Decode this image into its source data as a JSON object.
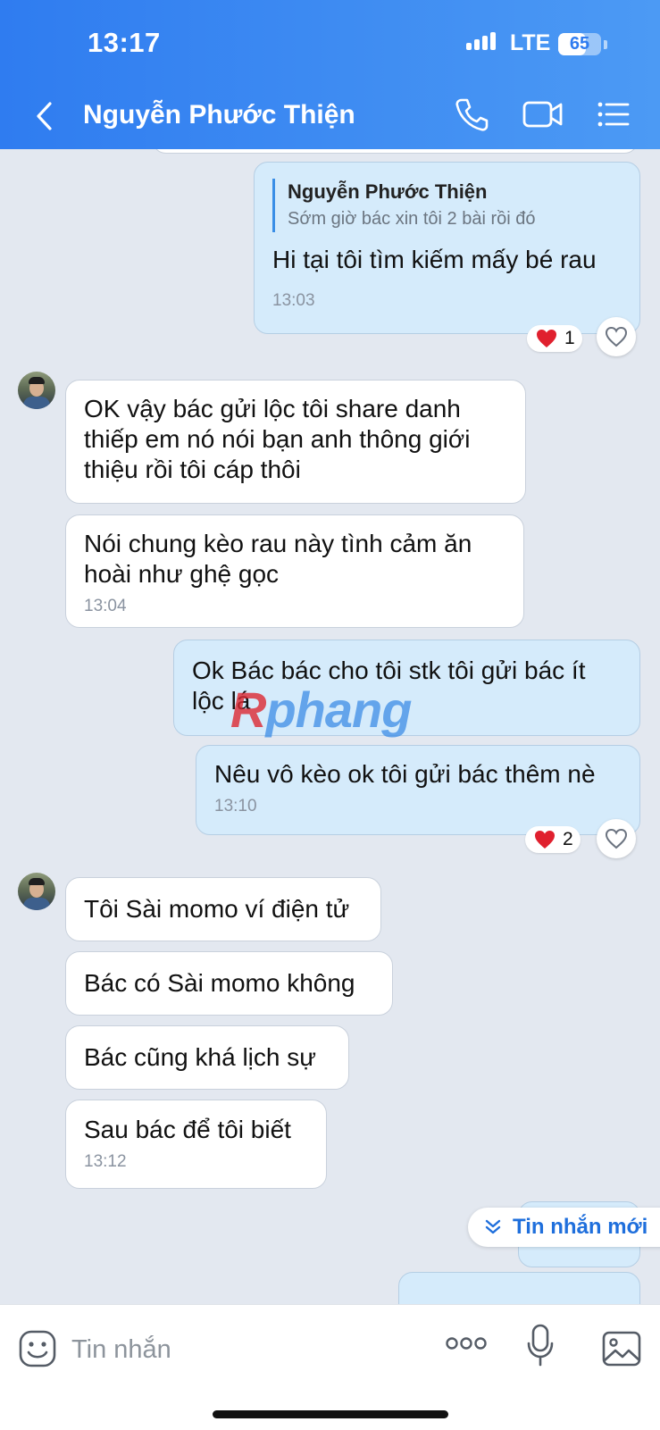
{
  "status_bar": {
    "time": "13:17",
    "network": "LTE",
    "battery": "65",
    "battery_level": 0.65
  },
  "header": {
    "contact_name": "Nguyễn Phước Thiện"
  },
  "messages": {
    "m1": {
      "quote_name": "Nguyễn Phước Thiện",
      "quote_text": "Sớm giờ bác xin tôi 2 bài rồi đó",
      "text": "Hi tại tôi tìm kiếm mấy bé rau",
      "time": "13:03",
      "reaction_count": "1"
    },
    "m2": {
      "text": "OK vậy bác gửi lộc tôi share danh thiếp em nó nói bạn anh thông giới thiệu rồi tôi cáp thôi"
    },
    "m3": {
      "text": "Nói chung kèo rau này tình cảm ăn hoài như ghệ gọc",
      "time": "13:04"
    },
    "m4": {
      "text": "Ok Bác bác cho tôi stk tôi gửi bác ít lộc lá"
    },
    "m5": {
      "text": "Nêu vô kèo ok tôi gửi bác thêm nè",
      "time": "13:10",
      "reaction_count": "2"
    },
    "m6": {
      "text": "Tôi Sài momo ví điện tử"
    },
    "m7": {
      "text": "Bác có Sài momo không"
    },
    "m8": {
      "text": "Bác cũng khá lịch sự"
    },
    "m9": {
      "text": "Sau bác để tôi biết",
      "time": "13:12"
    }
  },
  "watermark": {
    "prefix": "R",
    "text": "phang"
  },
  "new_messages_button": {
    "label": "Tin nhắn mới"
  },
  "composer": {
    "placeholder": "Tin nhắn"
  },
  "colors": {
    "header": "#2f7cf0",
    "my_bubble": "#d5ebfb",
    "their_bubble": "#ffffff",
    "background": "#e3e8f0",
    "reaction": "#e0202e"
  }
}
